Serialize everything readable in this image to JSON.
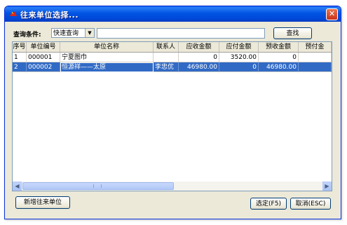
{
  "window": {
    "title": "往来单位选择...",
    "close_symbol": "✕"
  },
  "query": {
    "label": "查询条件:",
    "mode_value": "快速查询",
    "mode_arrow": "▼",
    "input_value": "",
    "search_label": "查找"
  },
  "table": {
    "columns": [
      "序号",
      "单位编号",
      "单位名称",
      "联系人",
      "应收金额",
      "应付金额",
      "预收金额",
      "预付金"
    ],
    "rows": [
      [
        "1",
        "000001",
        "宁夏图巾",
        "",
        "0",
        "3520.00",
        "0",
        ""
      ],
      [
        "2",
        "000002",
        "恒源祥——太原",
        "李忠优",
        "46980.00",
        "0",
        "46980.00",
        ""
      ]
    ],
    "selected_row_index": 1
  },
  "scrollbar": {
    "left_arrow": "◀",
    "right_arrow": "▶"
  },
  "footer": {
    "new_unit_label": "新增往来单位",
    "ok_label": "选定(F5)",
    "cancel_label": "取消(ESC)"
  },
  "colors": {
    "titlebar": "#0054e3",
    "selection": "#316ac5",
    "close_button": "#e35b3a",
    "dialog_bg": "#ece9d8"
  }
}
